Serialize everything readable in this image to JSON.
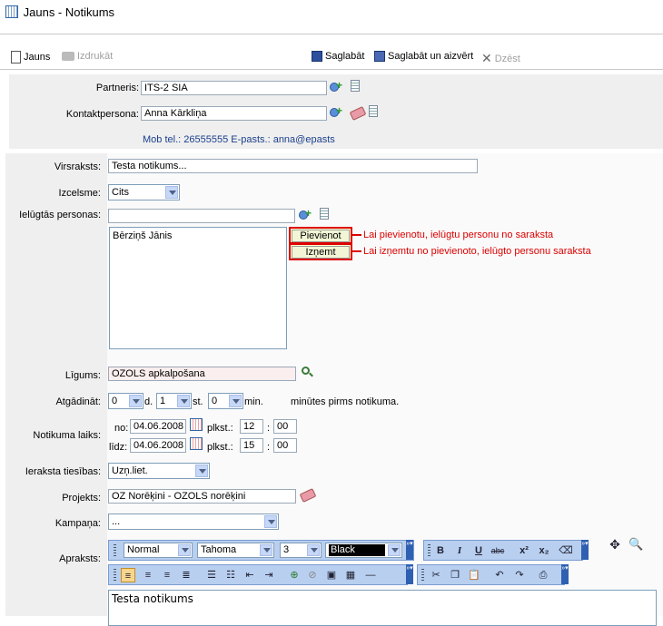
{
  "window": {
    "title": "Jauns - Notikums"
  },
  "toolbar": {
    "new_label": "Jauns",
    "print_label": "Izdrukāt",
    "save_label": "Saglabāt",
    "save_close_label": "Saglabāt un aizvērt",
    "delete_label": "Dzēst"
  },
  "partner": {
    "partner_label": "Partneris:",
    "partner_value": "ITS-2 SIA",
    "contact_label": "Kontaktpersona:",
    "contact_value": "Anna Kārkliņa",
    "contact_info": "Mob tel.: 26555555 E-pasts.: anna@epasts"
  },
  "form": {
    "subject_label": "Virsraksts:",
    "subject_value": "Testa notikums...",
    "origin_label": "Izcelsme:",
    "origin_value": "Cits",
    "invited_label": "Ielūgtās personas:",
    "invited_input": "",
    "invited_list": [
      "Bērziņš Jānis"
    ],
    "add_button": "Pievienot",
    "remove_button": "Izņemt",
    "add_hint": "Lai pievienotu, ielūgtu personu no saraksta",
    "remove_hint": "Lai izņemtu no pievienoto, ielūgto personu saraksta",
    "contract_label": "Līgums:",
    "contract_value": "OZOLS apkalpošana",
    "remind_label": "Atgādināt:",
    "remind_days": "0",
    "remind_days_unit": "d.",
    "remind_hours": "1",
    "remind_hours_unit": "st.",
    "remind_minutes": "0",
    "remind_minutes_unit": "min.",
    "remind_suffix": "minūtes pirms notikuma.",
    "time_label": "Notikuma laiks:",
    "from_label": "no:",
    "from_date": "04.06.2008",
    "from_plkst": "plkst.:",
    "from_hour": "12",
    "from_minute": "00",
    "to_label": "līdz:",
    "to_date": "04.06.2008",
    "to_plkst": "plkst.:",
    "to_hour": "15",
    "to_minute": "00",
    "colon": ":",
    "rights_label": "Ieraksta tiesības:",
    "rights_value": "Uzņ.liet.",
    "project_label": "Projekts:",
    "project_value": "OZ Norēķini - OZOLS norēķini",
    "campaign_label": "Kampaņa:",
    "campaign_value": "...",
    "description_label": "Apraksts:"
  },
  "editor": {
    "style_value": "Normal",
    "font_value": "Tahoma",
    "size_value": "3",
    "color_value": "Black",
    "content": "Testa notikums"
  }
}
